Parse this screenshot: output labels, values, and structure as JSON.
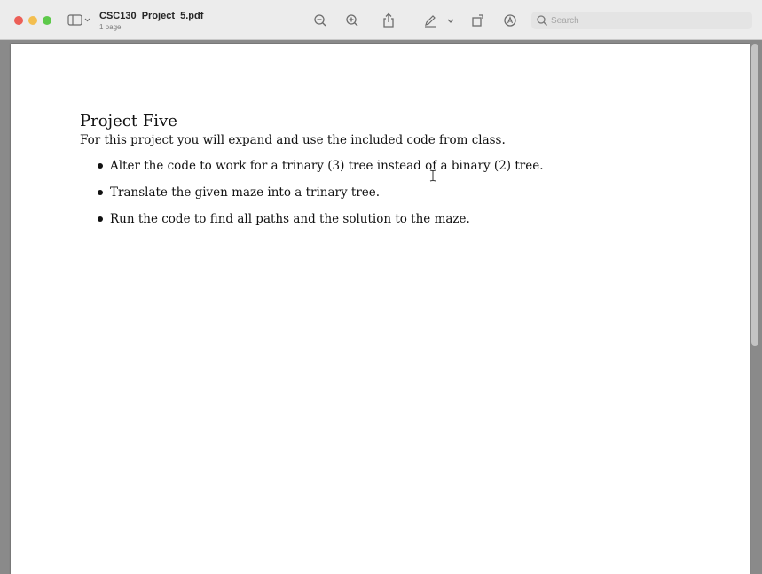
{
  "window": {
    "document_title": "CSC130_Project_5.pdf",
    "page_count": "1 page"
  },
  "toolbar": {
    "icons": [
      "sidebar-icon",
      "zoom-out-icon",
      "zoom-in-icon",
      "share-icon",
      "markup-pen-icon",
      "chevron-down-icon",
      "rotate-icon",
      "annotate-icon"
    ]
  },
  "search": {
    "placeholder": "Search",
    "value": ""
  },
  "document": {
    "heading": "Project Five",
    "intro": "For this project you will expand and use the included code from class.",
    "bullets": [
      "Alter the code to work for a trinary (3) tree instead of a binary (2) tree.",
      "Translate the given maze into a trinary tree.",
      "Run the code to find all paths and the solution to the maze."
    ]
  },
  "colors": {
    "close": "#ec5f57",
    "minimize": "#f3be4f",
    "maximize": "#5dc94a",
    "toolbar_bg": "#ececec",
    "viewer_bg": "#8a8a8a"
  }
}
